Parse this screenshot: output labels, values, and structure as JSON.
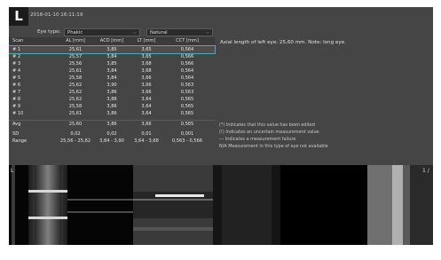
{
  "header": {
    "eye": "L",
    "timestamp": "2018-01-10 16:11:19"
  },
  "settings": {
    "eye_type_label": "Eye type:",
    "eye_type_value": "Phakic",
    "lens_value": "Natural"
  },
  "table": {
    "columns": [
      "Scan",
      "AL [mm]",
      "ACD [mm]",
      "LT [mm]",
      "CCT [mm]"
    ],
    "rows": [
      [
        "# 1",
        "25,61",
        "3,85",
        "3,65",
        "0,564"
      ],
      [
        "# 2",
        "25,57",
        "3,84",
        "3,65",
        "0,566"
      ],
      [
        "# 3",
        "25,56",
        "3,85",
        "3,68",
        "0,566"
      ],
      [
        "# 4",
        "25,61",
        "3,84",
        "3,68",
        "0,564"
      ],
      [
        "# 5",
        "25,58",
        "3,84",
        "3,66",
        "0,564"
      ],
      [
        "# 6",
        "25,62",
        "3,90",
        "3,66",
        "0,563"
      ],
      [
        "# 7",
        "25,62",
        "3,86",
        "3,66",
        "0,563"
      ],
      [
        "# 8",
        "25,62",
        "3,88",
        "3,64",
        "0,565"
      ],
      [
        "# 9",
        "25,58",
        "3,86",
        "3,64",
        "0,565"
      ],
      [
        "# 10",
        "25,61",
        "3,86",
        "3,64",
        "0,565"
      ]
    ],
    "stats": [
      [
        "Avg",
        "25,60",
        "3,86",
        "3,66",
        "0,565"
      ],
      [
        "SD",
        "0,02",
        "0,02",
        "0,01",
        "0,001"
      ],
      [
        "Range",
        "25,56 - 25,62",
        "3,84 - 3,90",
        "3,64 - 3,68",
        "0,563 - 0,566"
      ]
    ]
  },
  "note": "Axial length of left eye: 25,60 mm. Note: long eye.",
  "legend": [
    "(*)  Indicates that this value has been edited",
    "(!)  Indicates an uncertain measurement value",
    "---  Indicates a measurement failure",
    "N/A Measurement in this type of eye not available"
  ],
  "scans": {
    "label_left": "L",
    "label_right": "1 /"
  },
  "colors": {
    "panel": "#454545",
    "selection": "#5aa6b8"
  }
}
